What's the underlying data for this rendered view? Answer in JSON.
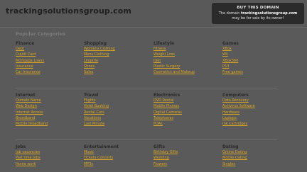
{
  "header": {
    "site": "trackingsolutionsgroup.com",
    "buy_title": "BUY THIS DOMAIN",
    "buy_prefix": "The domain",
    "buy_domain": "trackingsolutionsgroup.com",
    "buy_suffix": "may be for sale by its owner!"
  },
  "popular": {
    "title": "Popular Categories"
  },
  "rows": [
    {
      "cols": [
        {
          "title": "Finance",
          "links": [
            "Debt",
            "Credit Card",
            "Mortgage Loans",
            "Insurance",
            "Car Insurance"
          ]
        },
        {
          "title": "Shopping",
          "links": [
            "Womens Clothing",
            "Mens Clothing",
            "Lingerie",
            "Shoes",
            "Sales"
          ]
        },
        {
          "title": "Lifestyle",
          "links": [
            "Fitness",
            "Weight Loss",
            "Diet",
            "Plastic Surgery",
            "Cosmetics and Makeup"
          ]
        },
        {
          "title": "Games",
          "links": [
            "XBox",
            "Wii",
            "XBox360",
            "PS3",
            "Free games"
          ]
        }
      ]
    },
    {
      "cols": [
        {
          "title": "Internet",
          "links": [
            "Domain Name",
            "Web Design",
            "Internet Access",
            "Broadband",
            "Mobile Broadband"
          ]
        },
        {
          "title": "Travel",
          "links": [
            "Flights",
            "Hotel Booking",
            "Rental Cars",
            "Vacations",
            "Last Minute"
          ]
        },
        {
          "title": "Electronics",
          "links": [
            "DVD Rental",
            "Mobile Phones",
            "Digital Cameras",
            "Telephones",
            "PDAs"
          ]
        },
        {
          "title": "Computers",
          "links": [
            "Data Recovery",
            "Antivirus Software",
            "Hardware",
            "Laptops",
            "Ink Cartridges"
          ]
        }
      ]
    },
    {
      "cols": [
        {
          "title": "Jobs",
          "links": [
            "Job vacancies",
            "Part time Jobs",
            "Home work"
          ]
        },
        {
          "title": "Entertainment",
          "links": [
            "Music",
            "Tickets Concerts",
            "MP3s"
          ]
        },
        {
          "title": "Gifts",
          "links": [
            "Birthday Gifts",
            "Wedding",
            "Flowers"
          ]
        },
        {
          "title": "Dating",
          "links": [
            "Online Dating",
            "Mobile Dating",
            "Singles"
          ]
        }
      ]
    }
  ]
}
